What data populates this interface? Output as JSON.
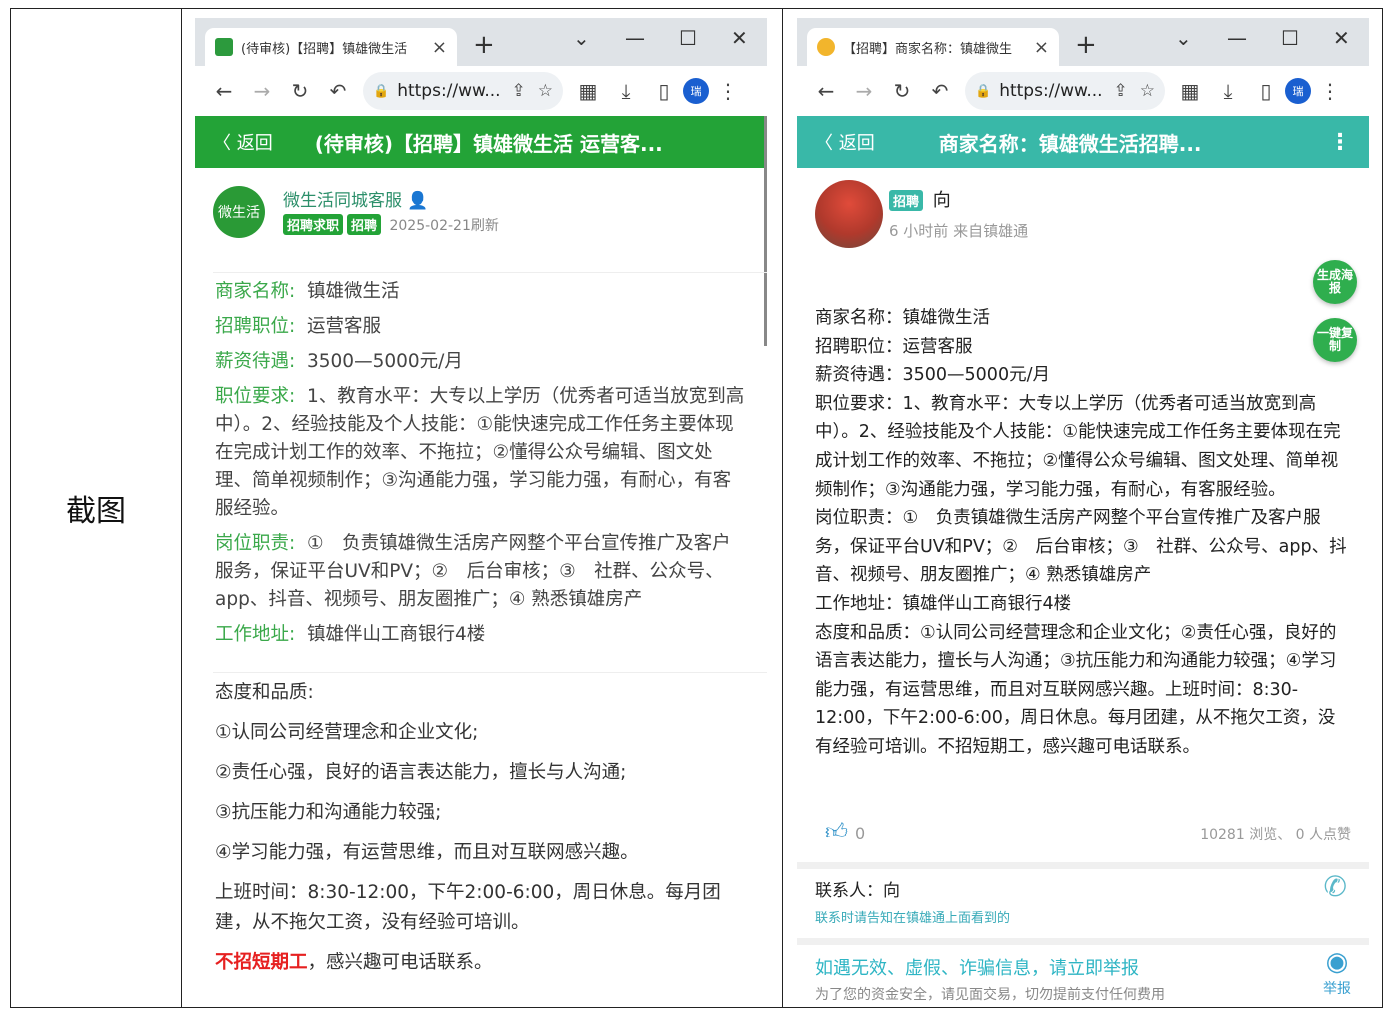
{
  "caption": "截图",
  "left": {
    "tab_title": "(待审核)【招聘】镇雄微生活",
    "tab_close": "×",
    "new_tab": "+",
    "window_controls": [
      "⌄",
      "—",
      "☐",
      "✕"
    ],
    "url": "https://ww...",
    "profile": "瑞",
    "appbar": {
      "back": "〈 返回",
      "title": "(待审核)【招聘】镇雄微生活 运营客...",
      "color": "#23a337"
    },
    "poster": {
      "logo_text": "微生活",
      "name": "微生活同城客服",
      "badges": [
        "招聘求职",
        "招聘"
      ],
      "date": "2025-02-21刷新"
    },
    "fields": [
      {
        "key": "商家名称:",
        "value": "镇雄微生活"
      },
      {
        "key": "招聘职位:",
        "value": "运营客服"
      },
      {
        "key": "薪资待遇:",
        "value": "3500—5000元/月"
      },
      {
        "key": "职位要求:",
        "value": "1、教育水平：大专以上学历（优秀者可适当放宽到高中）。2、经验技能及个人技能：①能快速完成工作任务主要体现在完成计划工作的效率、不拖拉；②懂得公众号编辑、图文处理、简单视频制作；③沟通能力强，学习能力强，有耐心，有客服经验。"
      },
      {
        "key": "岗位职责:",
        "value": "①　负责镇雄微生活房产网整个平台宣传推广及客户服务，保证平台UV和PV；②　后台审核；③　社群、公众号、app、抖音、视频号、朋友圈推广；④ 熟悉镇雄房产"
      },
      {
        "key": "工作地址:",
        "value": "镇雄伴山工商银行4楼"
      }
    ],
    "attitude": [
      "态度和品质:",
      "①认同公司经营理念和企业文化;",
      "②责任心强，良好的语言表达能力，擅长与人沟通;",
      "③抗压能力和沟通能力较强;",
      "④学习能力强，有运营思维，而且对互联网感兴趣。",
      "上班时间：8:30-12:00，下午2:00-6:00，周日休息。每月团建，从不拖欠工资，没有经验可培训。"
    ],
    "no_short_term": "不招短期工",
    "contact_line": "，感兴趣可电话联系。"
  },
  "right": {
    "tab_title": "【招聘】商家名称：镇雄微生",
    "tab_close": "×",
    "new_tab": "+",
    "window_controls": [
      "⌄",
      "—",
      "☐",
      "✕"
    ],
    "url": "https://ww...",
    "profile": "瑞",
    "appbar": {
      "back": "〈 返回",
      "title": "商家名称：镇雄微生活招聘...",
      "dots": "⋮",
      "color": "#39b8a8"
    },
    "poster": {
      "badge": "招聘",
      "name": "向",
      "time_from": "6 小时前 来自镇雄通"
    },
    "float_buttons": [
      "生成海报",
      "一键复制"
    ],
    "body_lines": [
      "商家名称：镇雄微生活",
      "招聘职位：运营客服",
      "薪资待遇：3500—5000元/月",
      "职位要求：1、教育水平：大专以上学历（优秀者可适当放宽到高中）。2、经验技能及个人技能：①能快速完成工作任务主要体现在完成计划工作的效率、不拖拉；②懂得公众号编辑、图文处理、简单视频制作；③沟通能力强，学习能力强，有耐心，有客服经验。",
      "岗位职责：①　负责镇雄微生活房产网整个平台宣传推广及客户服务，保证平台UV和PV；②　后台审核；③　社群、公众号、app、抖音、视频号、朋友圈推广；④ 熟悉镇雄房产",
      "工作地址：镇雄伴山工商银行4楼",
      "态度和品质：①认同公司经营理念和企业文化；②责任心强，良好的语言表达能力，擅长与人沟通；③抗压能力和沟通能力较强；④学习能力强，有运营思维，而且对互联网感兴趣。上班时间：8:30-12:00，下午2:00-6:00，周日休息。每月团建，从不拖欠工资，没有经验可培训。不招短期工，感兴趣可电话联系。"
    ],
    "likes": "0",
    "stats": "10281 浏览、 0 人点赞",
    "contact": "联系人：向",
    "contact_hint": "联系时请告知在镇雄通上面看到的",
    "report_title": "如遇无效、虚假、诈骗信息，请立即举报",
    "report_hint": "为了您的资金安全，请见面交易，切勿提前支付任何费用",
    "report_btn": "举报"
  }
}
